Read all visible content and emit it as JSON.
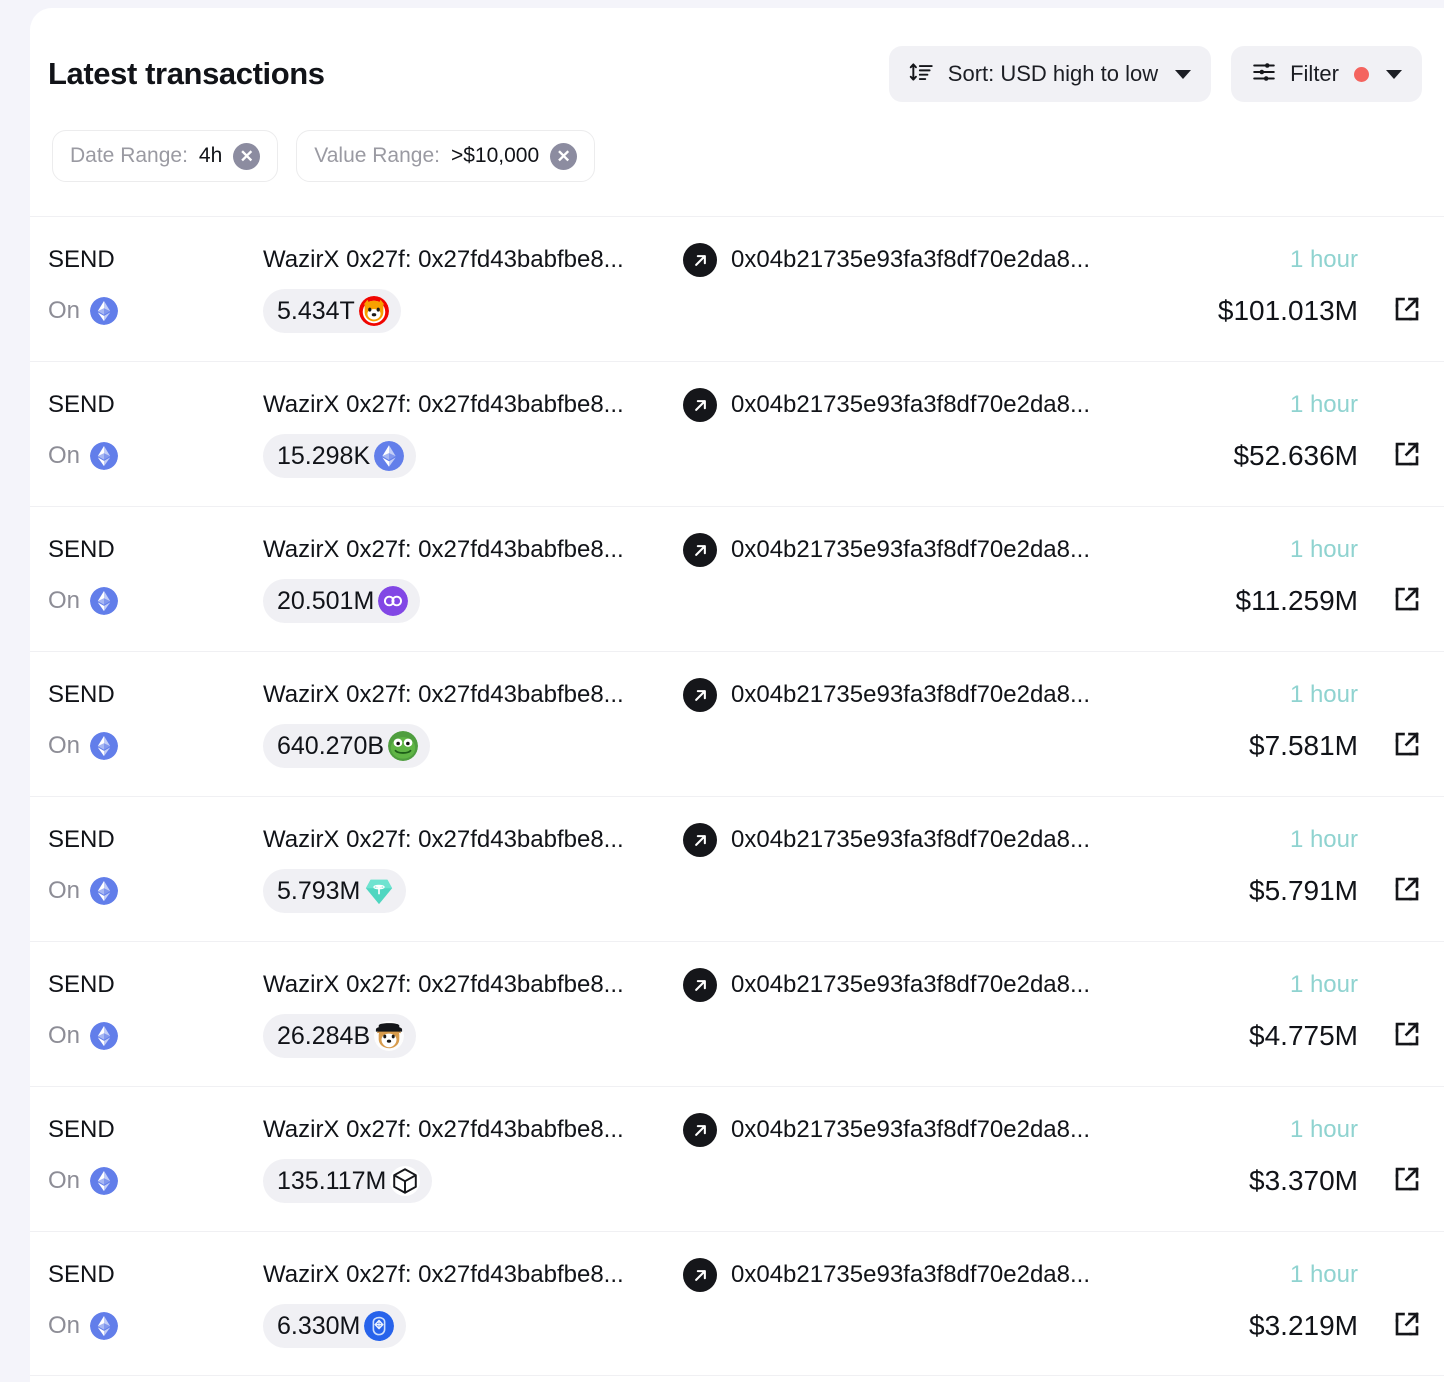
{
  "header": {
    "title": "Latest transactions",
    "sort_button": {
      "label": "Sort: USD high to low",
      "icon": "sort-icon"
    },
    "filter_button": {
      "label": "Filter",
      "icon": "sliders-icon",
      "indicator_color": "#f4645f"
    }
  },
  "filter_chips": [
    {
      "label": "Date Range:",
      "value": "4h",
      "remove_icon": "close-circle-icon"
    },
    {
      "label": "Value Range:",
      "value": ">$10,000",
      "remove_icon": "close-circle-icon"
    }
  ],
  "colors": {
    "page_background": "#f4f4fa",
    "card_background": "#ffffff",
    "time_accent": "#8fd3d0",
    "muted_text": "#8d8d96",
    "pill_background": "#f0f0f4",
    "divider": "#f0f0f3"
  },
  "transactions": [
    {
      "type": "SEND",
      "on_label": "On",
      "chain": "ethereum",
      "from": "WazirX 0x27f: 0x27fd43babfbe8...",
      "to": "0x04b21735e93fa3f8df70e2da8...",
      "amount": "5.434T",
      "token": "shiba-inu",
      "time": "1 hour",
      "usd": "$101.013M"
    },
    {
      "type": "SEND",
      "on_label": "On",
      "chain": "ethereum",
      "from": "WazirX 0x27f: 0x27fd43babfbe8...",
      "to": "0x04b21735e93fa3f8df70e2da8...",
      "amount": "15.298K",
      "token": "ethereum",
      "time": "1 hour",
      "usd": "$52.636M"
    },
    {
      "type": "SEND",
      "on_label": "On",
      "chain": "ethereum",
      "from": "WazirX 0x27f: 0x27fd43babfbe8...",
      "to": "0x04b21735e93fa3f8df70e2da8...",
      "amount": "20.501M",
      "token": "polygon",
      "time": "1 hour",
      "usd": "$11.259M"
    },
    {
      "type": "SEND",
      "on_label": "On",
      "chain": "ethereum",
      "from": "WazirX 0x27f: 0x27fd43babfbe8...",
      "to": "0x04b21735e93fa3f8df70e2da8...",
      "amount": "640.270B",
      "token": "pepe",
      "time": "1 hour",
      "usd": "$7.581M"
    },
    {
      "type": "SEND",
      "on_label": "On",
      "chain": "ethereum",
      "from": "WazirX 0x27f: 0x27fd43babfbe8...",
      "to": "0x04b21735e93fa3f8df70e2da8...",
      "amount": "5.793M",
      "token": "tether-diamond",
      "time": "1 hour",
      "usd": "$5.791M"
    },
    {
      "type": "SEND",
      "on_label": "On",
      "chain": "ethereum",
      "from": "WazirX 0x27f: 0x27fd43babfbe8...",
      "to": "0x04b21735e93fa3f8df70e2da8...",
      "amount": "26.284B",
      "token": "floki",
      "time": "1 hour",
      "usd": "$4.775M"
    },
    {
      "type": "SEND",
      "on_label": "On",
      "chain": "ethereum",
      "from": "WazirX 0x27f: 0x27fd43babfbe8...",
      "to": "0x04b21735e93fa3f8df70e2da8...",
      "amount": "135.117M",
      "token": "cube",
      "time": "1 hour",
      "usd": "$3.370M"
    },
    {
      "type": "SEND",
      "on_label": "On",
      "chain": "ethereum",
      "from": "WazirX 0x27f: 0x27fd43babfbe8...",
      "to": "0x04b21735e93fa3f8df70e2da8...",
      "amount": "6.330M",
      "token": "blue-token",
      "time": "1 hour",
      "usd": "$3.219M"
    }
  ]
}
